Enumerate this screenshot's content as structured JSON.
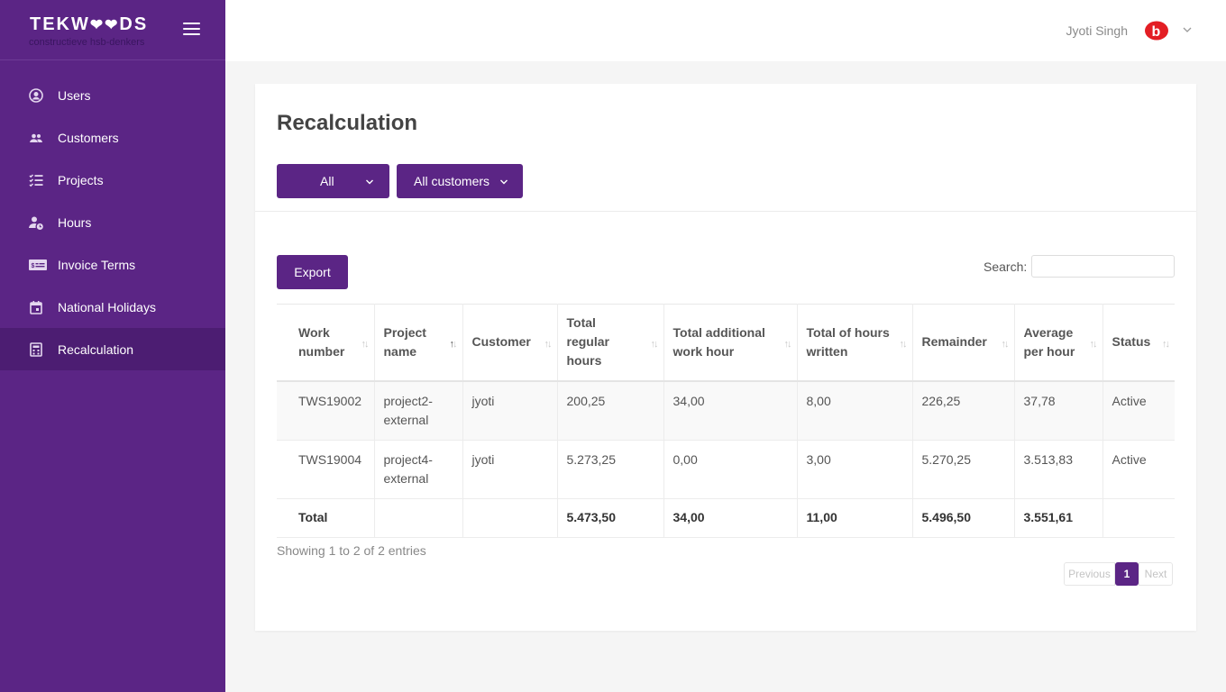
{
  "brand": {
    "name": "TEKW❤❤DS",
    "tagline": "constructieve hsb-denkers"
  },
  "sidebar": {
    "items": [
      {
        "label": "Users",
        "icon": "user-circle-icon"
      },
      {
        "label": "Customers",
        "icon": "people-icon"
      },
      {
        "label": "Projects",
        "icon": "checklist-icon"
      },
      {
        "label": "Hours",
        "icon": "user-clock-icon"
      },
      {
        "label": "Invoice Terms",
        "icon": "invoice-icon"
      },
      {
        "label": "National Holidays",
        "icon": "calendar-icon"
      },
      {
        "label": "Recalculation",
        "icon": "calculator-icon"
      }
    ],
    "active": "Recalculation"
  },
  "header": {
    "username": "Jyoti Singh",
    "avatar_icon": "brand-badge-icon"
  },
  "page": {
    "title": "Recalculation",
    "filter_status": "All",
    "filter_customer": "All customers",
    "export_label": "Export",
    "search_label": "Search:",
    "search_value": ""
  },
  "table": {
    "columns": [
      "Work number",
      "Project name",
      "Customer",
      "Total regular hours",
      "Total additional work hour",
      "Total of hours written",
      "Remainder",
      "Average per hour",
      "Status"
    ],
    "rows": [
      [
        "TWS19002",
        "project2-external",
        "jyoti",
        "200,25",
        "34,00",
        "8,00",
        "226,25",
        "37,78",
        "Active"
      ],
      [
        "TWS19004",
        "project4-external",
        "jyoti",
        "5.273,25",
        "0,00",
        "3,00",
        "5.270,25",
        "3.513,83",
        "Active"
      ]
    ],
    "total": [
      "Total",
      "",
      "",
      "5.473,50",
      "34,00",
      "11,00",
      "5.496,50",
      "3.551,61",
      ""
    ]
  },
  "footer": {
    "info": "Showing 1 to 2 of 2 entries",
    "prev": "Previous",
    "page": "1",
    "next": "Next"
  },
  "colors": {
    "brand_purple": "#5b2585",
    "sidebar_active": "#4c1d72",
    "badge_red": "#e31e24"
  }
}
